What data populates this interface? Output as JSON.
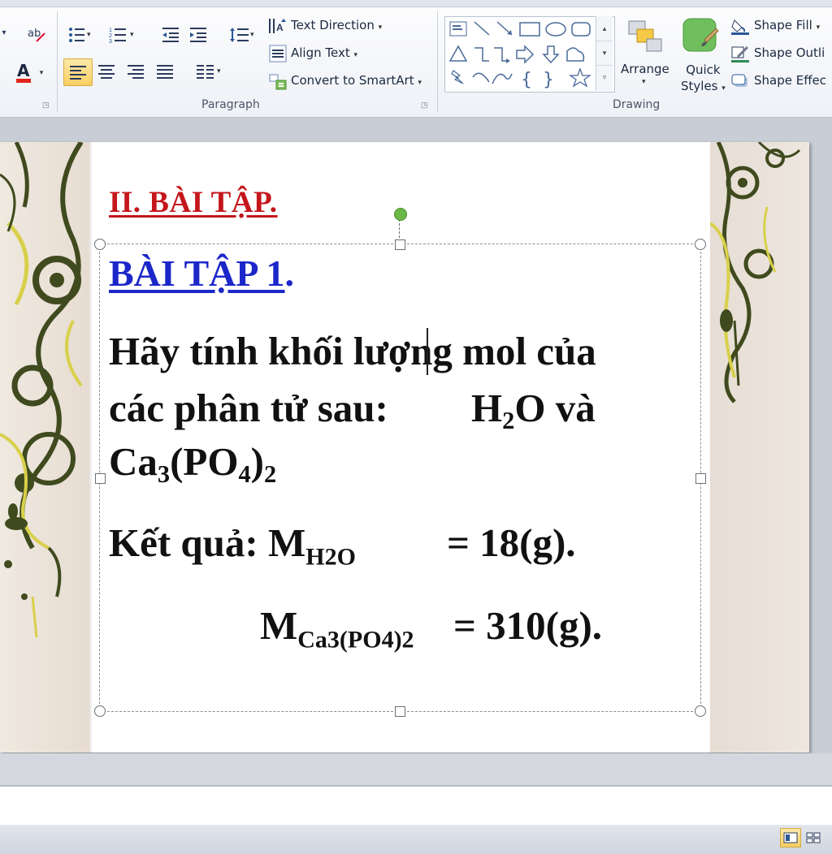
{
  "ribbon": {
    "paragraph": {
      "group_label": "Paragraph",
      "text_direction_label": "Text Direction",
      "align_text_label": "Align Text",
      "convert_smartart_label": "Convert to SmartArt",
      "active_alignment": "align-left"
    },
    "drawing": {
      "group_label": "Drawing",
      "arrange_label": "Arrange",
      "quick_styles_label_1": "Quick",
      "quick_styles_label_2": "Styles",
      "shape_fill_label": "Shape Fill",
      "shape_outline_label": "Shape Outli",
      "shape_effects_label": "Shape Effec"
    },
    "accent_colors": {
      "font_color": "#e2261c",
      "active_button": "#f7cf62"
    }
  },
  "slide": {
    "heading": "II. BÀI TẬP.",
    "exercise_title": "BÀI TẬP 1",
    "exercise_title_suffix": ".",
    "question_line1": "Hãy tính khối lượng mol của",
    "question_line2_prefix": "các phân tử sau:",
    "h2o_h": "H",
    "h2o_sub": "2",
    "h2o_o": "O",
    "conjunction": "và",
    "ca_symbol": "Ca",
    "ca_sub": "3",
    "po_open": "(PO",
    "po_sub": "4",
    "po_close": ")",
    "po_outer_sub": "2",
    "result_label": "Kết quả:",
    "m_symbol": "M",
    "m1_sub": "H2O",
    "m1_value": "= 18(g).",
    "m2_sub": "Ca3(PO4)2",
    "m2_value": "= 310(g).",
    "heading_color": "#c4161c",
    "title_color": "#1c27c9"
  },
  "status_bar": {
    "views": [
      "normal-view",
      "slide-sorter-view"
    ],
    "active_view": "normal-view"
  }
}
